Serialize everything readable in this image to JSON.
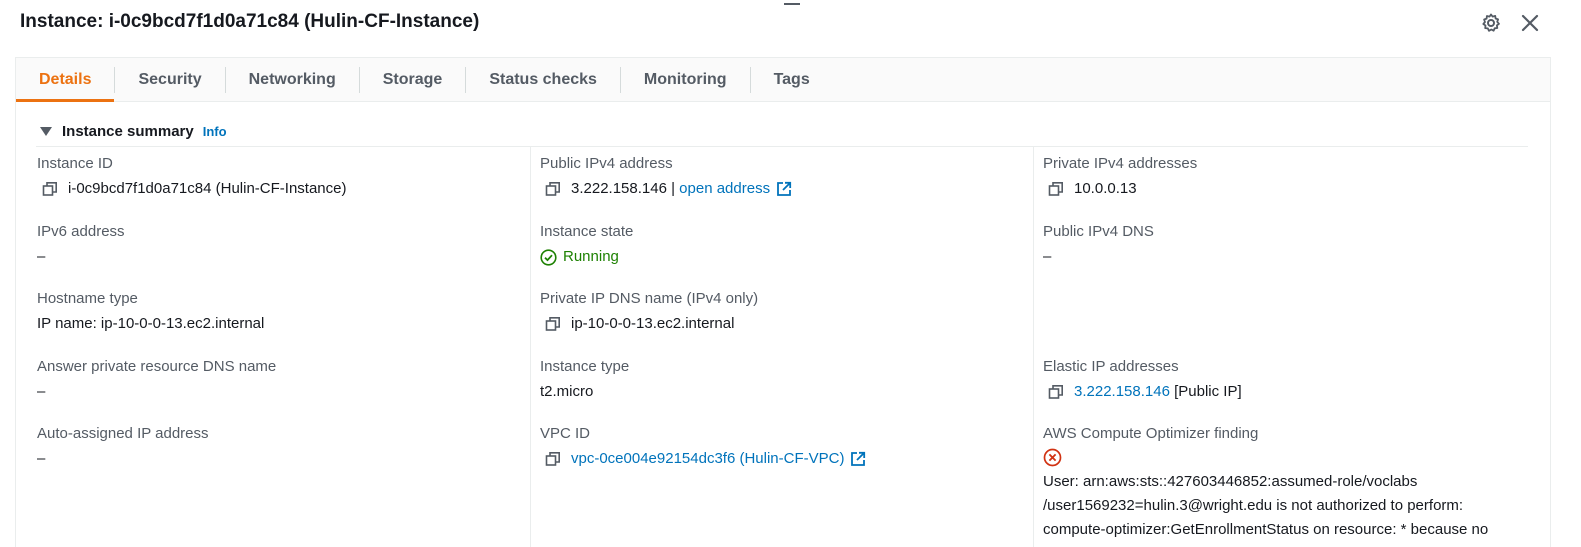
{
  "header": {
    "title": "Instance: i-0c9bcd7f1d0a71c84 (Hulin-CF-Instance)"
  },
  "tabs": [
    {
      "label": "Details",
      "active": true
    },
    {
      "label": "Security"
    },
    {
      "label": "Networking"
    },
    {
      "label": "Storage"
    },
    {
      "label": "Status checks"
    },
    {
      "label": "Monitoring"
    },
    {
      "label": "Tags"
    }
  ],
  "summary": {
    "title": "Instance summary",
    "info_label": "Info",
    "col1": {
      "instance_id": {
        "label": "Instance ID",
        "value": "i-0c9bcd7f1d0a71c84 (Hulin-CF-Instance)"
      },
      "ipv6": {
        "label": "IPv6 address",
        "value": "–"
      },
      "hostname_type": {
        "label": "Hostname type",
        "value": "IP name: ip-10-0-0-13.ec2.internal"
      },
      "answer_dns": {
        "label": "Answer private resource DNS name",
        "value": "–"
      },
      "auto_ip": {
        "label": "Auto-assigned IP address",
        "value": "–"
      }
    },
    "col2": {
      "public_ipv4": {
        "label": "Public IPv4 address",
        "value": "3.222.158.146",
        "separator": " | ",
        "link": "open address"
      },
      "instance_state": {
        "label": "Instance state",
        "value": "Running"
      },
      "private_dns": {
        "label": "Private IP DNS name (IPv4 only)",
        "value": "ip-10-0-0-13.ec2.internal"
      },
      "instance_type": {
        "label": "Instance type",
        "value": "t2.micro"
      },
      "vpc_id": {
        "label": "VPC ID",
        "value": "vpc-0ce004e92154dc3f6 (Hulin-CF-VPC)"
      }
    },
    "col3": {
      "private_ipv4": {
        "label": "Private IPv4 addresses",
        "value": "10.0.0.13"
      },
      "public_dns": {
        "label": "Public IPv4 DNS",
        "value": "–"
      },
      "elastic_ip": {
        "label": "Elastic IP addresses",
        "link": "3.222.158.146",
        "suffix": " [Public IP]"
      },
      "optimizer": {
        "label": "AWS Compute Optimizer finding",
        "error_lines": [
          "User: arn:aws:sts::427603446852:assumed-role/voclabs",
          "/user1569232=hulin.3@wright.edu is not authorized to perform:",
          "compute-optimizer:GetEnrollmentStatus on resource: * because no"
        ]
      }
    }
  },
  "colors": {
    "accent": "#ec7211",
    "link": "#0073bb",
    "success": "#1d8102",
    "error": "#d13212"
  }
}
